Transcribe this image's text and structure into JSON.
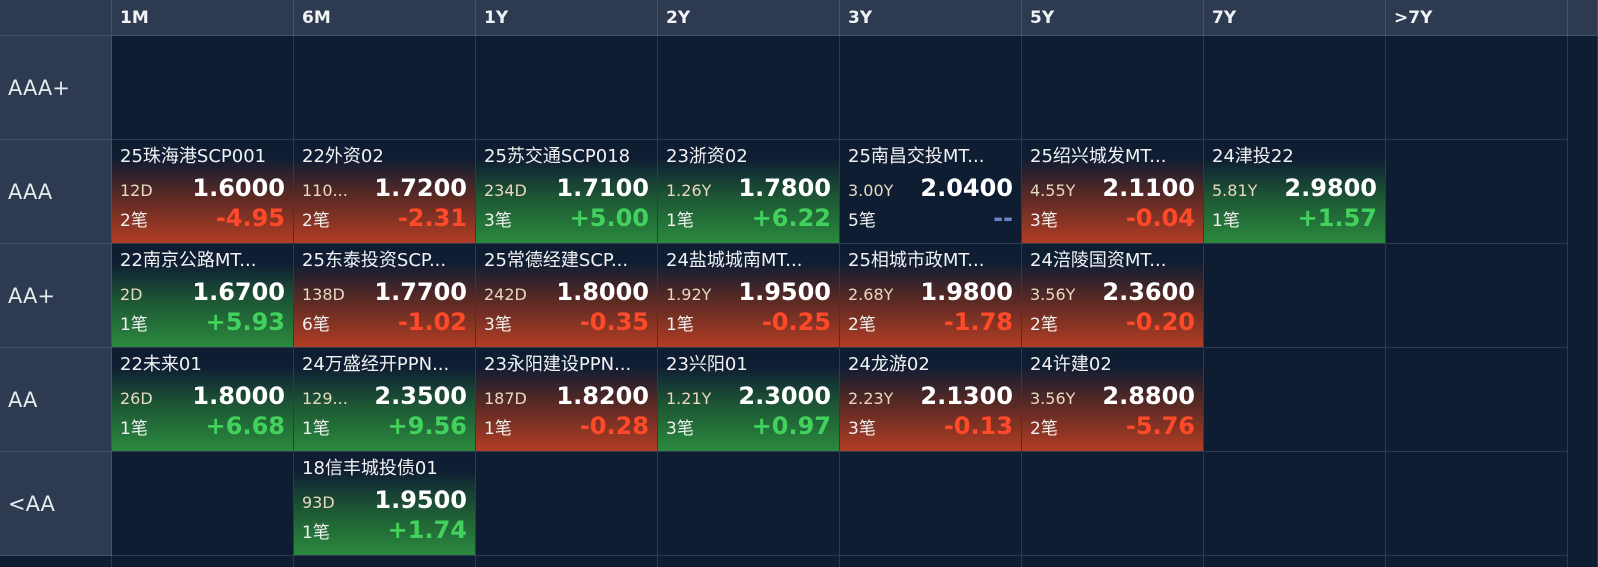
{
  "columns": [
    "1M",
    "6M",
    "1Y",
    "2Y",
    "3Y",
    "5Y",
    "7Y",
    ">7Y"
  ],
  "rows": [
    {
      "label": "AAA+",
      "cells": [
        null,
        null,
        null,
        null,
        null,
        null,
        null,
        null
      ]
    },
    {
      "label": "AAA",
      "cells": [
        {
          "name": "25珠海港SCP001",
          "term": "12D",
          "price": "1.6000",
          "count": "2笔",
          "change": "-4.95",
          "dir": "neg"
        },
        {
          "name": "22外资02",
          "term": "110...",
          "price": "1.7200",
          "count": "2笔",
          "change": "-2.31",
          "dir": "neg"
        },
        {
          "name": "25苏交通SCP018",
          "term": "234D",
          "price": "1.7100",
          "count": "3笔",
          "change": "+5.00",
          "dir": "pos"
        },
        {
          "name": "23浙资02",
          "term": "1.26Y",
          "price": "1.7800",
          "count": "1笔",
          "change": "+6.22",
          "dir": "pos"
        },
        {
          "name": "25南昌交投MT...",
          "term": "3.00Y",
          "price": "2.0400",
          "count": "5笔",
          "change": "--",
          "dir": "flat"
        },
        {
          "name": "25绍兴城发MT...",
          "term": "4.55Y",
          "price": "2.1100",
          "count": "3笔",
          "change": "-0.04",
          "dir": "neg"
        },
        {
          "name": "24津投22",
          "term": "5.81Y",
          "price": "2.9800",
          "count": "1笔",
          "change": "+1.57",
          "dir": "pos"
        },
        null
      ]
    },
    {
      "label": "AA+",
      "cells": [
        {
          "name": "22南京公路MT...",
          "term": "2D",
          "price": "1.6700",
          "count": "1笔",
          "change": "+5.93",
          "dir": "pos"
        },
        {
          "name": "25东泰投资SCP...",
          "term": "138D",
          "price": "1.7700",
          "count": "6笔",
          "change": "-1.02",
          "dir": "neg"
        },
        {
          "name": "25常德经建SCP...",
          "term": "242D",
          "price": "1.8000",
          "count": "3笔",
          "change": "-0.35",
          "dir": "neg"
        },
        {
          "name": "24盐城城南MT...",
          "term": "1.92Y",
          "price": "1.9500",
          "count": "1笔",
          "change": "-0.25",
          "dir": "neg"
        },
        {
          "name": "25相城市政MT...",
          "term": "2.68Y",
          "price": "1.9800",
          "count": "2笔",
          "change": "-1.78",
          "dir": "neg"
        },
        {
          "name": "24涪陵国资MT...",
          "term": "3.56Y",
          "price": "2.3600",
          "count": "2笔",
          "change": "-0.20",
          "dir": "neg"
        },
        null,
        null
      ]
    },
    {
      "label": "AA",
      "cells": [
        {
          "name": "22未来01",
          "term": "26D",
          "price": "1.8000",
          "count": "1笔",
          "change": "+6.68",
          "dir": "pos"
        },
        {
          "name": "24万盛经开PPN...",
          "term": "129...",
          "price": "2.3500",
          "count": "1笔",
          "change": "+9.56",
          "dir": "pos"
        },
        {
          "name": "23永阳建设PPN...",
          "term": "187D",
          "price": "1.8200",
          "count": "1笔",
          "change": "-0.28",
          "dir": "neg"
        },
        {
          "name": "23兴阳01",
          "term": "1.21Y",
          "price": "2.3000",
          "count": "3笔",
          "change": "+0.97",
          "dir": "pos"
        },
        {
          "name": "24龙游02",
          "term": "2.23Y",
          "price": "2.1300",
          "count": "3笔",
          "change": "-0.13",
          "dir": "neg"
        },
        {
          "name": "24许建02",
          "term": "3.56Y",
          "price": "2.8800",
          "count": "2笔",
          "change": "-5.76",
          "dir": "neg"
        },
        null,
        null
      ]
    },
    {
      "label": "<AA",
      "cells": [
        null,
        {
          "name": "18信丰城投债01",
          "term": "93D",
          "price": "1.9500",
          "count": "1笔",
          "change": "+1.74",
          "dir": "pos"
        },
        null,
        null,
        null,
        null,
        null,
        null
      ]
    }
  ],
  "colors": {
    "background": "#0f1d33",
    "header": "#2d3a4f",
    "negative": "#ff4a2a",
    "positive": "#43d15e",
    "flat": "#6b86c7"
  }
}
